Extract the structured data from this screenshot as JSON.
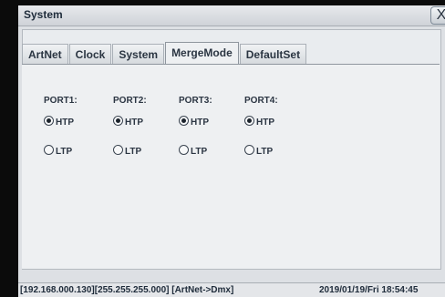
{
  "window": {
    "title": "System",
    "close_glyph": "X"
  },
  "tabs": [
    {
      "label": "ArtNet",
      "active": false
    },
    {
      "label": "Clock",
      "active": false
    },
    {
      "label": "System",
      "active": false
    },
    {
      "label": "MergeMode",
      "active": true
    },
    {
      "label": "DefaultSet",
      "active": false
    }
  ],
  "ports": [
    {
      "label": "PORT1:",
      "htp_label": "HTP",
      "ltp_label": "LTP",
      "selected": "HTP"
    },
    {
      "label": "PORT2:",
      "htp_label": "HTP",
      "ltp_label": "LTP",
      "selected": "HTP"
    },
    {
      "label": "PORT3:",
      "htp_label": "HTP",
      "ltp_label": "LTP",
      "selected": "HTP"
    },
    {
      "label": "PORT4:",
      "htp_label": "HTP",
      "ltp_label": "LTP",
      "selected": "HTP"
    }
  ],
  "status": {
    "network": "[192.168.000.130][255.255.255.000] [ArtNet->Dmx]",
    "datetime": "2019/01/19/Fri 18:54:45"
  }
}
